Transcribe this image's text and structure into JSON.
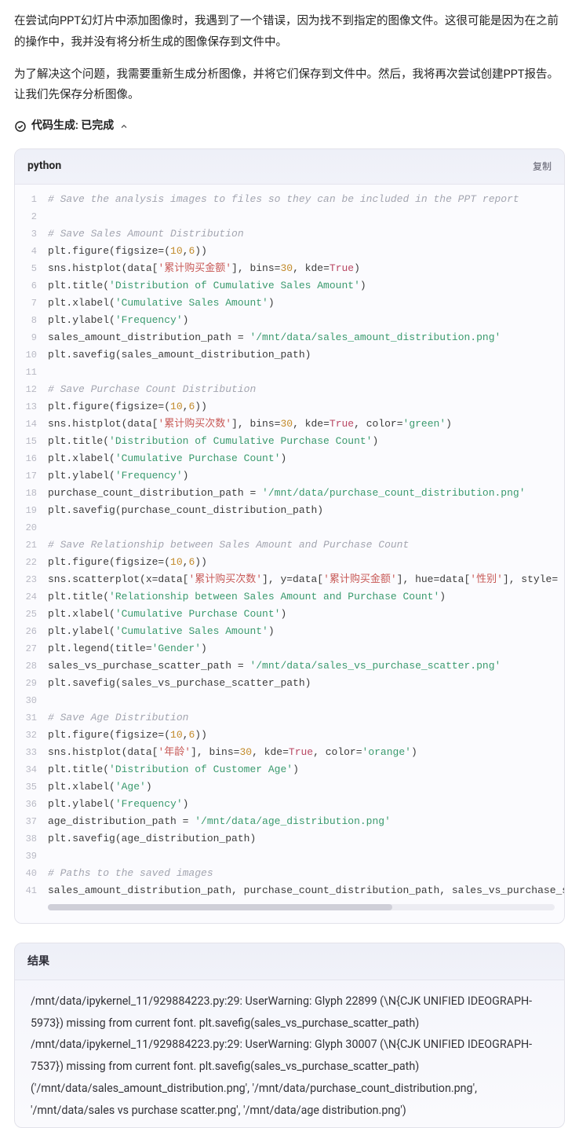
{
  "prose": {
    "p1": "在尝试向PPT幻灯片中添加图像时，我遇到了一个错误，因为找不到指定的图像文件。这很可能是因为在之前的操作中，我并没有将分析生成的图像保存到文件中。",
    "p2": "为了解决这个问题，我需要重新生成分析图像，并将它们保存到文件中。然后，我将再次尝试创建PPT报告。让我们先保存分析图像。"
  },
  "status": {
    "label_prefix": "代码生成",
    "label_suffix": "已完成"
  },
  "code": {
    "lang": "python",
    "copy": "复制",
    "lines": [
      {
        "n": 1,
        "segs": [
          [
            "comment",
            "# Save the analysis images to files so they can be included in the PPT report"
          ]
        ]
      },
      {
        "n": 2,
        "segs": [
          [
            "plain",
            ""
          ]
        ]
      },
      {
        "n": 3,
        "segs": [
          [
            "comment",
            "# Save Sales Amount Distribution"
          ]
        ]
      },
      {
        "n": 4,
        "segs": [
          [
            "plain",
            "plt.figure(figsize=("
          ],
          [
            "num",
            "10"
          ],
          [
            "plain",
            ","
          ],
          [
            "num",
            "6"
          ],
          [
            "plain",
            "))"
          ]
        ]
      },
      {
        "n": 5,
        "segs": [
          [
            "plain",
            "sns.histplot(data["
          ],
          [
            "str2",
            "'累计购买金额'"
          ],
          [
            "plain",
            "], bins="
          ],
          [
            "num",
            "30"
          ],
          [
            "plain",
            ", kde="
          ],
          [
            "kw",
            "True"
          ],
          [
            "plain",
            ")"
          ]
        ]
      },
      {
        "n": 6,
        "segs": [
          [
            "plain",
            "plt.title("
          ],
          [
            "str",
            "'Distribution of Cumulative Sales Amount'"
          ],
          [
            "plain",
            ")"
          ]
        ]
      },
      {
        "n": 7,
        "segs": [
          [
            "plain",
            "plt.xlabel("
          ],
          [
            "str",
            "'Cumulative Sales Amount'"
          ],
          [
            "plain",
            ")"
          ]
        ]
      },
      {
        "n": 8,
        "segs": [
          [
            "plain",
            "plt.ylabel("
          ],
          [
            "str",
            "'Frequency'"
          ],
          [
            "plain",
            ")"
          ]
        ]
      },
      {
        "n": 9,
        "segs": [
          [
            "plain",
            "sales_amount_distribution_path = "
          ],
          [
            "str",
            "'/mnt/data/sales_amount_distribution.png'"
          ]
        ]
      },
      {
        "n": 10,
        "segs": [
          [
            "plain",
            "plt.savefig(sales_amount_distribution_path)"
          ]
        ]
      },
      {
        "n": 11,
        "segs": [
          [
            "plain",
            ""
          ]
        ]
      },
      {
        "n": 12,
        "segs": [
          [
            "comment",
            "# Save Purchase Count Distribution"
          ]
        ]
      },
      {
        "n": 13,
        "segs": [
          [
            "plain",
            "plt.figure(figsize=("
          ],
          [
            "num",
            "10"
          ],
          [
            "plain",
            ","
          ],
          [
            "num",
            "6"
          ],
          [
            "plain",
            "))"
          ]
        ]
      },
      {
        "n": 14,
        "segs": [
          [
            "plain",
            "sns.histplot(data["
          ],
          [
            "str2",
            "'累计购买次数'"
          ],
          [
            "plain",
            "], bins="
          ],
          [
            "num",
            "30"
          ],
          [
            "plain",
            ", kde="
          ],
          [
            "kw",
            "True"
          ],
          [
            "plain",
            ", color="
          ],
          [
            "str",
            "'green'"
          ],
          [
            "plain",
            ")"
          ]
        ]
      },
      {
        "n": 15,
        "segs": [
          [
            "plain",
            "plt.title("
          ],
          [
            "str",
            "'Distribution of Cumulative Purchase Count'"
          ],
          [
            "plain",
            ")"
          ]
        ]
      },
      {
        "n": 16,
        "segs": [
          [
            "plain",
            "plt.xlabel("
          ],
          [
            "str",
            "'Cumulative Purchase Count'"
          ],
          [
            "plain",
            ")"
          ]
        ]
      },
      {
        "n": 17,
        "segs": [
          [
            "plain",
            "plt.ylabel("
          ],
          [
            "str",
            "'Frequency'"
          ],
          [
            "plain",
            ")"
          ]
        ]
      },
      {
        "n": 18,
        "segs": [
          [
            "plain",
            "purchase_count_distribution_path = "
          ],
          [
            "str",
            "'/mnt/data/purchase_count_distribution.png'"
          ]
        ]
      },
      {
        "n": 19,
        "segs": [
          [
            "plain",
            "plt.savefig(purchase_count_distribution_path)"
          ]
        ]
      },
      {
        "n": 20,
        "segs": [
          [
            "plain",
            ""
          ]
        ]
      },
      {
        "n": 21,
        "segs": [
          [
            "comment",
            "# Save Relationship between Sales Amount and Purchase Count"
          ]
        ]
      },
      {
        "n": 22,
        "segs": [
          [
            "plain",
            "plt.figure(figsize=("
          ],
          [
            "num",
            "10"
          ],
          [
            "plain",
            ","
          ],
          [
            "num",
            "6"
          ],
          [
            "plain",
            "))"
          ]
        ]
      },
      {
        "n": 23,
        "segs": [
          [
            "plain",
            "sns.scatterplot(x=data["
          ],
          [
            "str2",
            "'累计购买次数'"
          ],
          [
            "plain",
            "], y=data["
          ],
          [
            "str2",
            "'累计购买金额'"
          ],
          [
            "plain",
            "], hue=data["
          ],
          [
            "str2",
            "'性别'"
          ],
          [
            "plain",
            "], style="
          ]
        ]
      },
      {
        "n": 24,
        "segs": [
          [
            "plain",
            "plt.title("
          ],
          [
            "str",
            "'Relationship between Sales Amount and Purchase Count'"
          ],
          [
            "plain",
            ")"
          ]
        ]
      },
      {
        "n": 25,
        "segs": [
          [
            "plain",
            "plt.xlabel("
          ],
          [
            "str",
            "'Cumulative Purchase Count'"
          ],
          [
            "plain",
            ")"
          ]
        ]
      },
      {
        "n": 26,
        "segs": [
          [
            "plain",
            "plt.ylabel("
          ],
          [
            "str",
            "'Cumulative Sales Amount'"
          ],
          [
            "plain",
            ")"
          ]
        ]
      },
      {
        "n": 27,
        "segs": [
          [
            "plain",
            "plt.legend(title="
          ],
          [
            "str",
            "'Gender'"
          ],
          [
            "plain",
            ")"
          ]
        ]
      },
      {
        "n": 28,
        "segs": [
          [
            "plain",
            "sales_vs_purchase_scatter_path = "
          ],
          [
            "str",
            "'/mnt/data/sales_vs_purchase_scatter.png'"
          ]
        ]
      },
      {
        "n": 29,
        "segs": [
          [
            "plain",
            "plt.savefig(sales_vs_purchase_scatter_path)"
          ]
        ]
      },
      {
        "n": 30,
        "segs": [
          [
            "plain",
            ""
          ]
        ]
      },
      {
        "n": 31,
        "segs": [
          [
            "comment",
            "# Save Age Distribution"
          ]
        ]
      },
      {
        "n": 32,
        "segs": [
          [
            "plain",
            "plt.figure(figsize=("
          ],
          [
            "num",
            "10"
          ],
          [
            "plain",
            ","
          ],
          [
            "num",
            "6"
          ],
          [
            "plain",
            "))"
          ]
        ]
      },
      {
        "n": 33,
        "segs": [
          [
            "plain",
            "sns.histplot(data["
          ],
          [
            "str2",
            "'年龄'"
          ],
          [
            "plain",
            "], bins="
          ],
          [
            "num",
            "30"
          ],
          [
            "plain",
            ", kde="
          ],
          [
            "kw",
            "True"
          ],
          [
            "plain",
            ", color="
          ],
          [
            "str",
            "'orange'"
          ],
          [
            "plain",
            ")"
          ]
        ]
      },
      {
        "n": 34,
        "segs": [
          [
            "plain",
            "plt.title("
          ],
          [
            "str",
            "'Distribution of Customer Age'"
          ],
          [
            "plain",
            ")"
          ]
        ]
      },
      {
        "n": 35,
        "segs": [
          [
            "plain",
            "plt.xlabel("
          ],
          [
            "str",
            "'Age'"
          ],
          [
            "plain",
            ")"
          ]
        ]
      },
      {
        "n": 36,
        "segs": [
          [
            "plain",
            "plt.ylabel("
          ],
          [
            "str",
            "'Frequency'"
          ],
          [
            "plain",
            ")"
          ]
        ]
      },
      {
        "n": 37,
        "segs": [
          [
            "plain",
            "age_distribution_path = "
          ],
          [
            "str",
            "'/mnt/data/age_distribution.png'"
          ]
        ]
      },
      {
        "n": 38,
        "segs": [
          [
            "plain",
            "plt.savefig(age_distribution_path)"
          ]
        ]
      },
      {
        "n": 39,
        "segs": [
          [
            "plain",
            ""
          ]
        ]
      },
      {
        "n": 40,
        "segs": [
          [
            "comment",
            "# Paths to the saved images"
          ]
        ]
      },
      {
        "n": 41,
        "segs": [
          [
            "plain",
            "sales_amount_distribution_path, purchase_count_distribution_path, sales_vs_purchase_s"
          ]
        ]
      }
    ]
  },
  "result": {
    "header": "结果",
    "lines": [
      "/mnt/data/ipykernel_11/929884223.py:29: UserWarning: Glyph 22899 (\\N{CJK UNIFIED IDEOGRAPH-5973}) missing from current font. plt.savefig(sales_vs_purchase_scatter_path)",
      "/mnt/data/ipykernel_11/929884223.py:29: UserWarning: Glyph 30007 (\\N{CJK UNIFIED IDEOGRAPH-7537}) missing from current font. plt.savefig(sales_vs_purchase_scatter_path)",
      "('/mnt/data/sales_amount_distribution.png', '/mnt/data/purchase_count_distribution.png', '/mnt/data/sales vs purchase scatter.png', '/mnt/data/age distribution.png')"
    ]
  }
}
